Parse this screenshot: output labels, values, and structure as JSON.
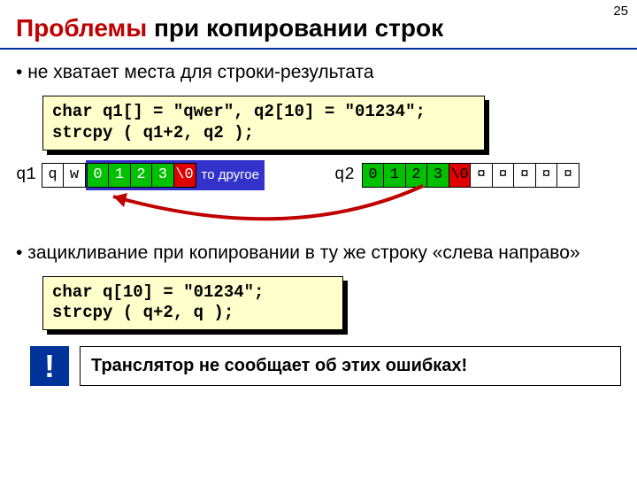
{
  "page_number": "25",
  "title": {
    "accent": "Проблемы",
    "rest": " при копировании строк"
  },
  "bullet1": "не хватает места для строки-результата",
  "code1": "char q1[] = \"qwer\", q2[10] = \"01234\";\nstrcpy ( q1+2, q2 );",
  "diagram": {
    "q1_label": "q1",
    "q1_cells_white": [
      "q",
      "w"
    ],
    "blue_cells": [
      {
        "v": "0",
        "cls": "green"
      },
      {
        "v": "1",
        "cls": "green"
      },
      {
        "v": "2",
        "cls": "green"
      },
      {
        "v": "3",
        "cls": "green"
      },
      {
        "v": "\\0",
        "cls": "red"
      }
    ],
    "blue_text": "то другое",
    "q2_label": "q2",
    "q2_cells": [
      {
        "v": "0",
        "cls": "green"
      },
      {
        "v": "1",
        "cls": "green"
      },
      {
        "v": "2",
        "cls": "green"
      },
      {
        "v": "3",
        "cls": "green"
      },
      {
        "v": "\\0",
        "cls": "red"
      },
      {
        "v": "¤",
        "cls": "white"
      },
      {
        "v": "¤",
        "cls": "white"
      },
      {
        "v": "¤",
        "cls": "white"
      },
      {
        "v": "¤",
        "cls": "white"
      },
      {
        "v": "¤",
        "cls": "white"
      }
    ]
  },
  "bullet2": "зацикливание при копировании в ту же строку «слева направо»",
  "code2": "char q[10] = \"01234\";\nstrcpy ( q+2, q );",
  "warn": {
    "excl": "!",
    "text": "Транслятор не сообщает об этих ошибках!"
  }
}
